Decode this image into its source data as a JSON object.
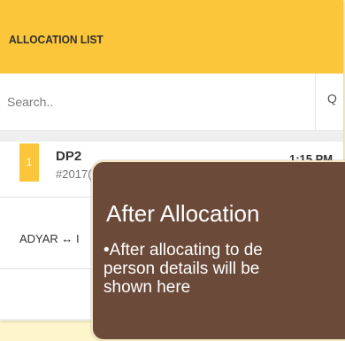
{
  "header": {
    "title": "ALLOCATION LIST"
  },
  "search": {
    "placeholder": "Search..",
    "button_label": "Q"
  },
  "orders": [
    {
      "index": "1",
      "name": "DP2",
      "id": "#2017(",
      "time": "1:15 PM",
      "route": "ADYAR ↔ I"
    }
  ],
  "callout": {
    "title": "After Allocation",
    "lines": [
      "•After allocating to de",
      "person details will be",
      "shown here"
    ]
  },
  "colors": {
    "header": "#fbc63a",
    "callout_bg": "#6b4a3a",
    "page_bg": "#fef5cd"
  }
}
